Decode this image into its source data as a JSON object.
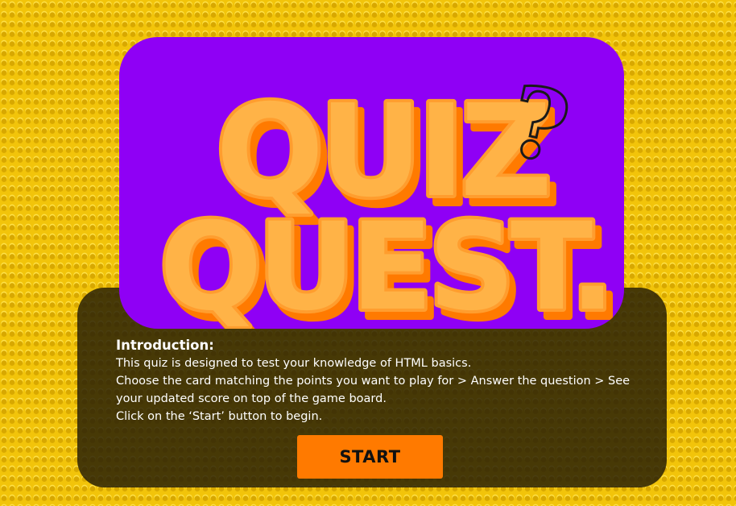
{
  "logo": {
    "line1": "QUIZ",
    "line2": "QUEST.",
    "symbol": "?"
  },
  "intro": {
    "heading": "Introduction:",
    "lines": [
      "This quiz is designed to test your knowledge of HTML basics.",
      "Choose the card matching the points you want to play for > Answer the question > See your updated score on top of the game board.",
      "Click on the ‘Start’ button to begin."
    ]
  },
  "start_button": {
    "label": "START"
  },
  "colors": {
    "background": "#f2c40a",
    "card": "#8f00f5",
    "logo_fill": "#ffb347",
    "logo_shadow": "#ff7a00",
    "panel": "#261e06",
    "button": "#ff7a00"
  }
}
